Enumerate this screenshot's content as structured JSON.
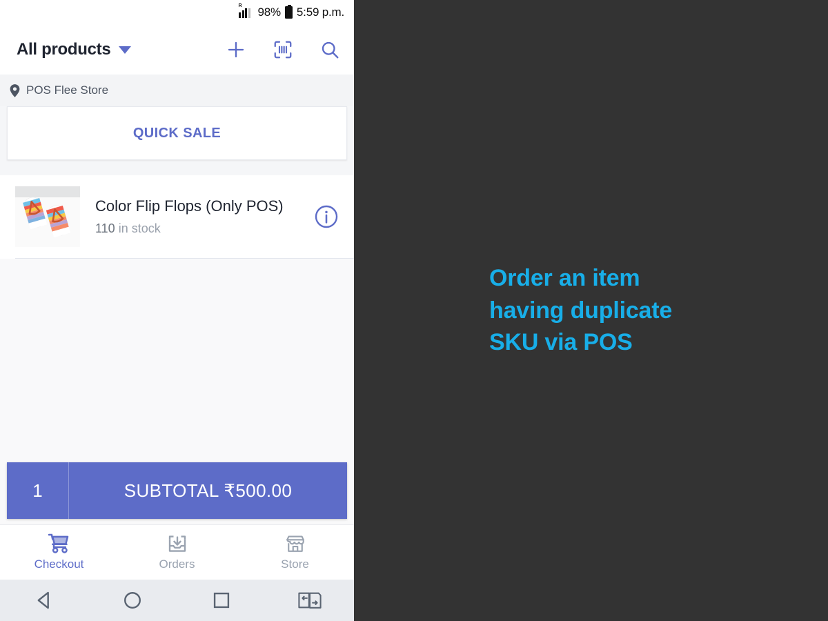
{
  "statusbar": {
    "signal_icon": "signal-bars-roaming-icon",
    "roaming_label": "R",
    "battery_percent": "98%",
    "battery_icon": "battery-full-icon",
    "time": "5:59 p.m."
  },
  "appbar": {
    "title": "All products",
    "dropdown_icon": "chevron-down-icon",
    "actions": [
      {
        "name": "add-product-button",
        "icon": "plus-icon"
      },
      {
        "name": "scan-barcode-button",
        "icon": "barcode-scan-icon"
      },
      {
        "name": "search-button",
        "icon": "search-icon"
      }
    ]
  },
  "store": {
    "pin_icon": "location-pin-icon",
    "name": "POS Flee Store"
  },
  "quick_sale": {
    "label": "QUICK SALE"
  },
  "products": [
    {
      "name": "Color Flip Flops (Only POS)",
      "stock_count": "110",
      "stock_suffix": " in stock",
      "stock_text": "110 in stock",
      "thumbnail_icon": "flip-flops-photo",
      "info_icon": "info-circle-icon"
    }
  ],
  "cart": {
    "quantity": "1",
    "subtotal_label": "SUBTOTAL ₹500.00"
  },
  "bottom_nav": [
    {
      "label": "Checkout",
      "icon": "shopping-cart-icon",
      "active": true
    },
    {
      "label": "Orders",
      "icon": "inbox-download-icon",
      "active": false
    },
    {
      "label": "Store",
      "icon": "storefront-icon",
      "active": false
    }
  ],
  "android_nav": [
    {
      "name": "back-button",
      "icon": "triangle-back-icon"
    },
    {
      "name": "home-button",
      "icon": "circle-home-icon"
    },
    {
      "name": "recents-button",
      "icon": "square-recents-icon"
    },
    {
      "name": "app-switch-button",
      "icon": "dual-window-switch-icon"
    }
  ],
  "annotation": {
    "text": "Order an item having duplicate SKU via POS",
    "color": "#18aee8",
    "background": "#333333"
  },
  "colors": {
    "accent": "#5d6cc8",
    "annotation_cyan": "#18aee8",
    "panel_bg": "#f5f6f8"
  }
}
